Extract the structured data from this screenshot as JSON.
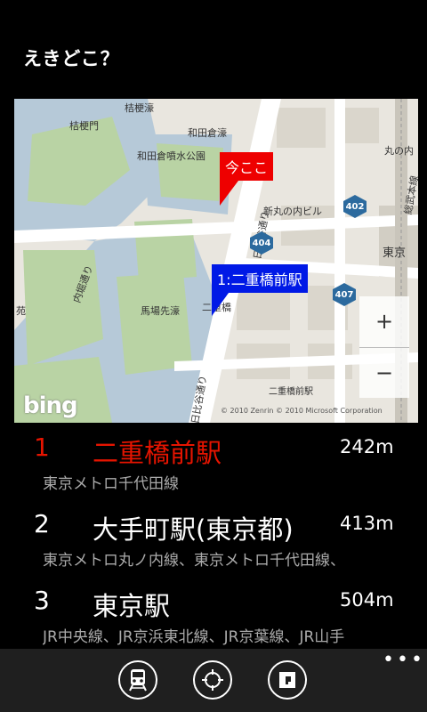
{
  "app": {
    "title": "えきどこ？"
  },
  "map": {
    "pins": {
      "current_location": "今ここ",
      "station_1": "1:二重橋前駅"
    },
    "labels": {
      "a": "桔梗濠",
      "b": "桔梗門",
      "c": "和田倉濠",
      "d": "和田倉噴水公園",
      "e": "新丸の内ビル",
      "f": "内堀通り",
      "g": "日比谷通り",
      "h": "馬場先濠",
      "i": "二重橋",
      "j": "東京",
      "k": "丸の内",
      "l": "総武本線",
      "m": "苑",
      "n": "日比谷通り",
      "o": "二重橋前駅"
    },
    "road_shields": [
      "402",
      "404",
      "407"
    ],
    "zoom_in": "+",
    "zoom_out": "−",
    "bing": "bing",
    "copyright": "© 2010 Zenrin     © 2010 Microsoft Corporation"
  },
  "results": [
    {
      "rank": "1",
      "name": "二重橋前駅",
      "distance": "242m",
      "lines": "東京メトロ千代田線"
    },
    {
      "rank": "2",
      "name": "大手町駅(東京都)",
      "distance": "413m",
      "lines": "東京メトロ丸ノ内線、東京メトロ千代田線、"
    },
    {
      "rank": "3",
      "name": "東京駅",
      "distance": "504m",
      "lines": "JR中央線、JR京浜東北線、JR京葉線、JR山手"
    }
  ],
  "appbar": {
    "more": "•••",
    "icons": [
      "train-icon",
      "location-icon",
      "info-icon"
    ]
  },
  "colors": {
    "accent_red": "#e51400",
    "pin_blue": "#0019e6",
    "water": "#b6c9d8",
    "park": "#b9d3a4"
  }
}
